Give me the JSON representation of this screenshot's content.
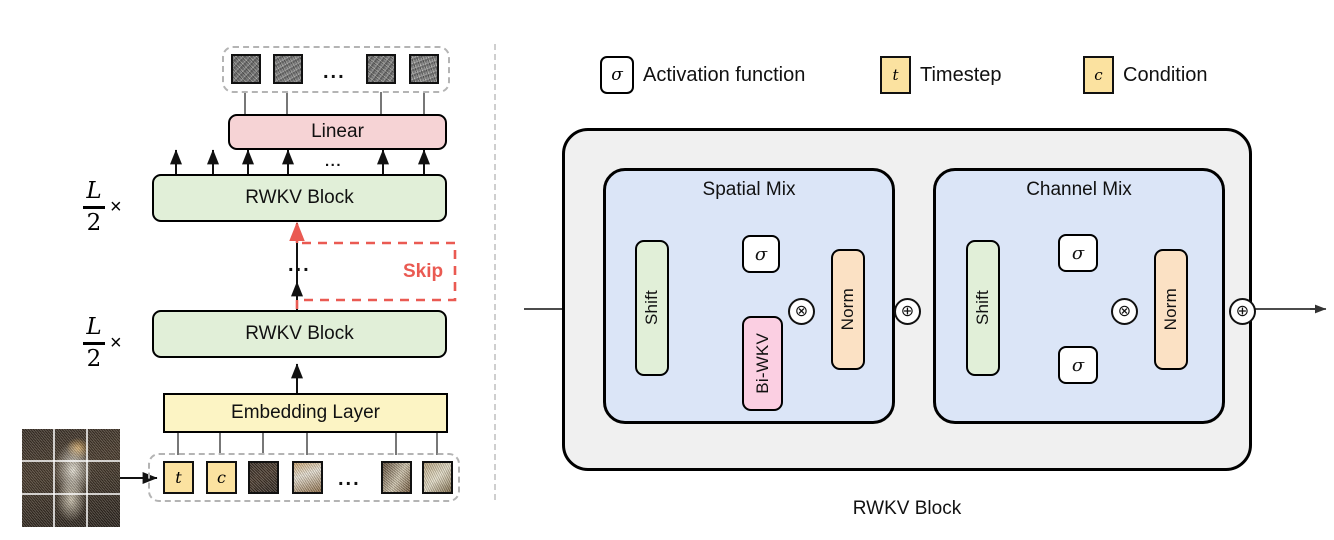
{
  "figure": {
    "left_panel": {
      "output_tokens_label": "noise-patch-tokens",
      "output_dots": "...",
      "linear": "Linear",
      "rwkv_top": "RWKV Block",
      "rwkv_bottom": "RWKV Block",
      "repeat_top": {
        "numerator": "L",
        "denominator": "2",
        "times": "×"
      },
      "repeat_bottom": {
        "numerator": "L",
        "denominator": "2",
        "times": "×"
      },
      "middle_dots": "...",
      "skip_label": "Skip",
      "skip_color": "#ea5a52",
      "embedding": "Embedding Layer",
      "input_tokens": [
        {
          "type": "text",
          "value": "t"
        },
        {
          "type": "text",
          "value": "c"
        },
        {
          "type": "patch",
          "value": ""
        },
        {
          "type": "patch",
          "value": ""
        },
        {
          "type": "dots",
          "value": "..."
        },
        {
          "type": "patch",
          "value": ""
        },
        {
          "type": "patch",
          "value": ""
        }
      ],
      "arrow_dots": "..."
    },
    "legend": [
      {
        "icon": "sigma-icon",
        "symbol": "σ",
        "label": "Activation function"
      },
      {
        "icon": "timestep-token-icon",
        "symbol": "t",
        "label": "Timestep"
      },
      {
        "icon": "condition-token-icon",
        "symbol": "c",
        "label": "Condition"
      }
    ],
    "right_panel": {
      "caption": "RWKV Block",
      "spatial_mix": {
        "title": "Spatial Mix",
        "shift": "Shift",
        "sigma": "σ",
        "biwkv": "Bi-WKV",
        "norm": "Norm",
        "multiply": "⊗",
        "add": "⊕"
      },
      "channel_mix": {
        "title": "Channel Mix",
        "shift": "Shift",
        "sigma_top": "σ",
        "sigma_bottom": "σ",
        "norm": "Norm",
        "multiply": "⊗",
        "add": "⊕"
      }
    },
    "colors": {
      "green": "#e1efd8",
      "pink": "#f6d3d5",
      "yellow": "#fcf4c4",
      "magenta": "#fbcfe2",
      "peach": "#fbe1c4",
      "blue": "#dbe5f7",
      "gray": "#f0f0f0",
      "token_yellow": "#fbe2a0",
      "skip_red": "#ea5a52",
      "dashed_gray": "#b4b4b4"
    }
  }
}
